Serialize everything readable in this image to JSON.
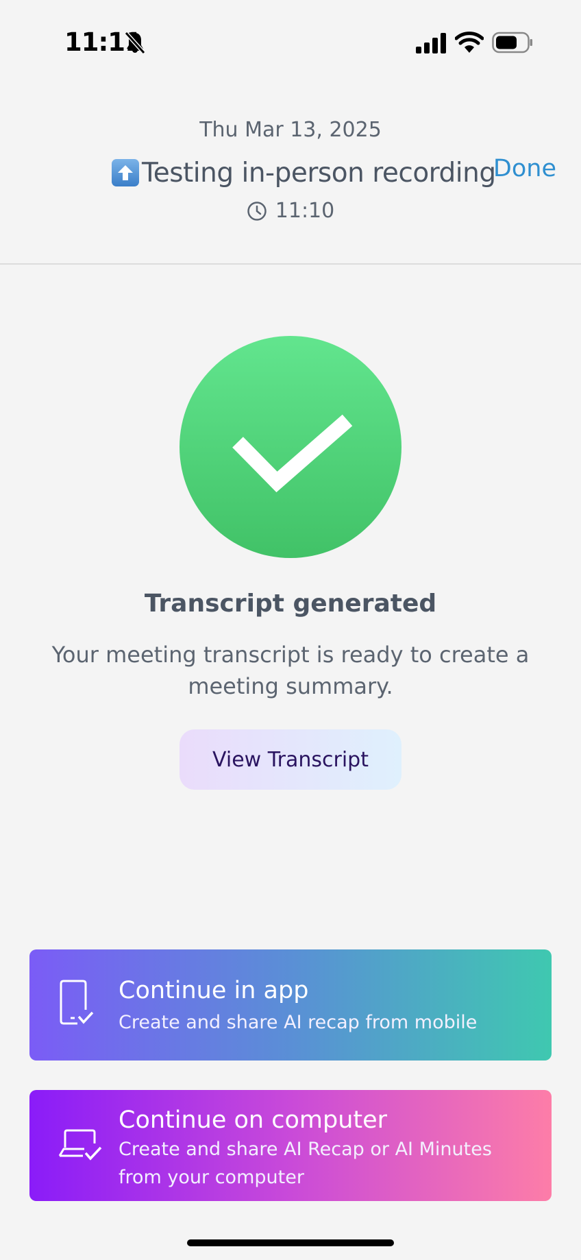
{
  "status_bar": {
    "time": "11:11",
    "icons": [
      "bell-slash-icon",
      "cellular-signal-icon",
      "wifi-icon",
      "battery-icon"
    ]
  },
  "header": {
    "date": "Thu Mar 13, 2025",
    "title_emoji_icon": "up-arrow-icon",
    "title": "Testing in-person recording",
    "done_label": "Done",
    "meeting_time": "11:10",
    "time_icon": "clock-icon"
  },
  "success": {
    "icon": "checkmark-circle-icon",
    "heading": "Transcript generated",
    "description": "Your meeting transcript is ready to create a meeting summary.",
    "view_button_label": "View Transcript"
  },
  "actions": [
    {
      "icon": "phone-check-icon",
      "title": "Continue in app",
      "subtitle": "Create and share AI recap from mobile"
    },
    {
      "icon": "laptop-check-icon",
      "title": "Continue on computer",
      "subtitle": "Create and share AI Recap or AI Minutes from your computer"
    }
  ],
  "colors": {
    "accent_link": "#2f8fd0",
    "success_green": "#4fd27a",
    "app_card_gradient": [
      "#7b5cf6",
      "#3fc8b0"
    ],
    "computer_card_gradient": [
      "#8a1cf8",
      "#fd7da8"
    ]
  }
}
